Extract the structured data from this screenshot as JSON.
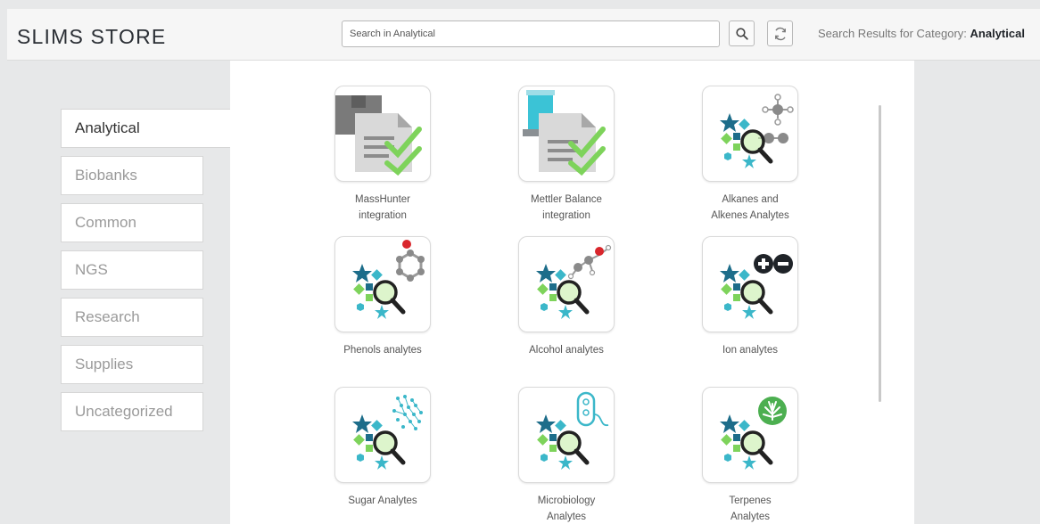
{
  "header": {
    "app_title": "SLIMS STORE",
    "search_placeholder": "Search in Analytical",
    "search_button_icon": "magnifier-icon",
    "refresh_button_icon": "refresh-icon",
    "results_prefix": "Search Results for Category: ",
    "results_category": "Analytical"
  },
  "sidebar": {
    "items": [
      {
        "label": "Analytical",
        "active": true
      },
      {
        "label": "Biobanks",
        "active": false
      },
      {
        "label": "Common",
        "active": false
      },
      {
        "label": "NGS",
        "active": false
      },
      {
        "label": "Research",
        "active": false
      },
      {
        "label": "Supplies",
        "active": false
      },
      {
        "label": "Uncategorized",
        "active": false
      }
    ]
  },
  "apps": [
    {
      "label": "MassHunter\nintegration",
      "icon": "document-instrument-icon"
    },
    {
      "label": "Mettler Balance\nintegration",
      "icon": "document-balance-icon"
    },
    {
      "label": "Alkanes and\nAlkenes Analytes",
      "icon": "analyte-molecule-icon"
    },
    {
      "label": "Phenols analytes",
      "icon": "analyte-phenol-icon"
    },
    {
      "label": "Alcohol analytes",
      "icon": "analyte-alcohol-icon"
    },
    {
      "label": "Ion analytes",
      "icon": "analyte-ion-icon"
    },
    {
      "label": "Sugar Analytes",
      "icon": "analyte-sugar-icon"
    },
    {
      "label": "Microbiology\nAnalytes",
      "icon": "analyte-microbe-icon"
    },
    {
      "label": "Terpenes\nAnalytes",
      "icon": "analyte-leaf-icon"
    }
  ],
  "colors": {
    "teal": "#1d6d8a",
    "green": "#7ed35b",
    "cyan": "#3bb7c9",
    "header_bg": "#f6f6f6",
    "content_bg": "#ffffff",
    "page_bg": "#e7e8e9"
  }
}
